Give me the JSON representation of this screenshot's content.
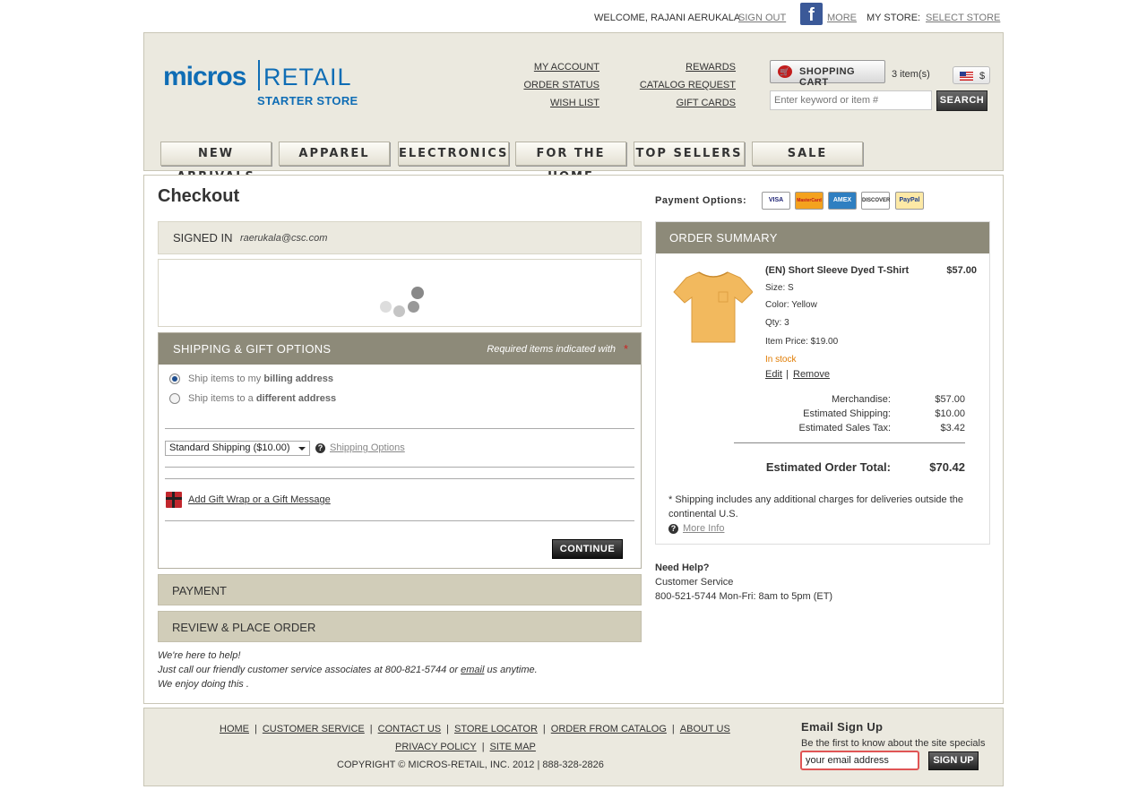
{
  "topbar": {
    "welcome": "WELCOME, RAJANI AERUKALA",
    "sign_out": "SIGN OUT",
    "more": "MORE",
    "my_store": "MY STORE:",
    "select_store": "SELECT STORE",
    "facebook_icon": "facebook-icon"
  },
  "logo": {
    "micros": "micros",
    "retail": "RETAIL",
    "starter": "STARTER STORE"
  },
  "header_links": {
    "my_account": "MY ACCOUNT",
    "order_status": "ORDER STATUS",
    "wish_list": "WISH LIST",
    "rewards": "REWARDS",
    "catalog_request": "CATALOG REQUEST",
    "gift_cards": "GIFT CARDS"
  },
  "cart": {
    "label": "SHOPPING CART",
    "count": "3 item(s)",
    "currency": "$"
  },
  "search": {
    "placeholder": "Enter keyword or item #",
    "button": "SEARCH"
  },
  "nav": [
    "NEW ARRIVALS",
    "APPAREL",
    "ELECTRONICS",
    "FOR THE HOME",
    "TOP SELLERS",
    "SALE"
  ],
  "checkout": {
    "title": "Checkout",
    "signed_in": {
      "label": "SIGNED IN",
      "email": "raerukala@csc.com"
    },
    "shipping": {
      "title": "SHIPPING & GIFT OPTIONS",
      "required_note": "Required items indicated with",
      "required_star": "*",
      "option1_prefix": "Ship items to my ",
      "option1_bold": "billing address",
      "option2_prefix": "Ship items to a ",
      "option2_bold": "different address",
      "method_selected": "Standard Shipping ($10.00)",
      "shipping_options_link": "Shipping Options",
      "gift_link": "Add Gift Wrap or a Gift Message",
      "continue": "CONTINUE"
    },
    "payment": "PAYMENT",
    "review": "REVIEW & PLACE ORDER",
    "help_lines": {
      "line1": "We're here to help!",
      "line2_prefix": "Just call our friendly customer service associates at 800-821-5744 or ",
      "line2_link": "email",
      "line2_suffix": " us anytime.",
      "line3": "We enjoy doing this ."
    }
  },
  "payment_options": {
    "label": "Payment Options:",
    "cards": [
      "VISA",
      "MasterCard",
      "AMEX",
      "DISCOVER",
      "PayPal"
    ]
  },
  "order_summary": {
    "title": "ORDER SUMMARY",
    "item": {
      "name": "(EN) Short Sleeve Dyed T-Shirt",
      "price": "$57.00",
      "size": "Size: S",
      "color": "Color: Yellow",
      "qty": "Qty: 3",
      "item_price": "Item Price: $19.00",
      "stock": "In stock",
      "edit": "Edit",
      "sep": "|",
      "remove": "Remove"
    },
    "totals": {
      "merch_label": "Merchandise:",
      "merch": "$57.00",
      "ship_label": "Estimated Shipping:",
      "ship": "$10.00",
      "tax_label": "Estimated Sales Tax:",
      "tax": "$3.42",
      "total_label": "Estimated Order Total:",
      "total": "$70.42"
    },
    "note": "* Shipping includes any additional charges for deliveries outside the continental U.S.",
    "more_info": "More Info"
  },
  "need_help": {
    "title": "Need Help?",
    "line1": "Customer Service",
    "line2": "800-521-5744 Mon-Fri: 8am to 5pm (ET)"
  },
  "footer": {
    "links_row1": [
      "HOME",
      "CUSTOMER SERVICE",
      "CONTACT US",
      "STORE LOCATOR",
      "ORDER FROM CATALOG",
      "ABOUT US"
    ],
    "links_row2": [
      "PRIVACY POLICY",
      "SITE MAP"
    ],
    "copyright": "COPYRIGHT © MICROS-RETAIL, INC. 2012 | 888-328-2826",
    "email_title": "Email Sign Up",
    "email_sub": "Be the first to know about the site specials",
    "email_value": "your email address",
    "signup": "SIGN UP"
  },
  "colors": {
    "header_bg": "#ebe9df",
    "panel_head": "#8d8a79",
    "panel_bar": "#d1cdb9",
    "brand_blue": "#0f6db5",
    "stock_orange": "#e07b00"
  }
}
